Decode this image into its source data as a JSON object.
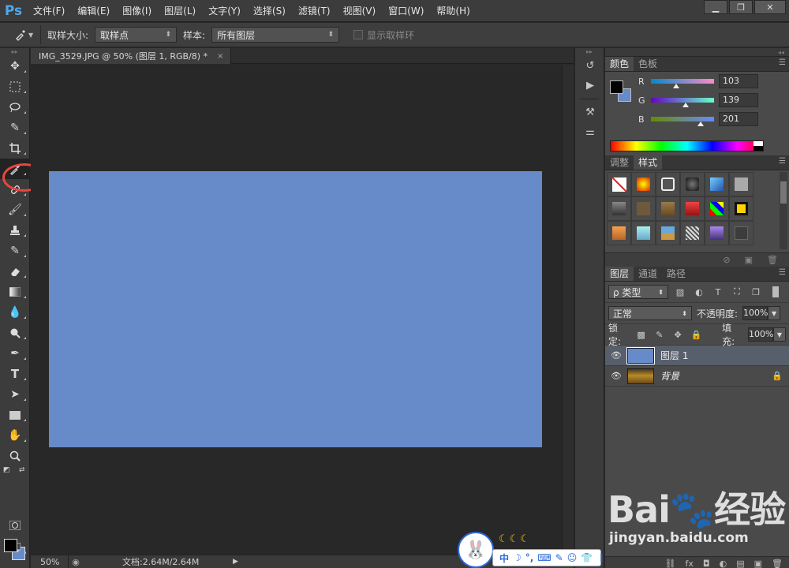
{
  "app": {
    "logo": "Ps"
  },
  "menu": [
    "文件(F)",
    "编辑(E)",
    "图像(I)",
    "图层(L)",
    "文字(Y)",
    "选择(S)",
    "滤镜(T)",
    "视图(V)",
    "窗口(W)",
    "帮助(H)"
  ],
  "window_controls": {
    "minimize": "▁",
    "restore": "❐",
    "close": "✕"
  },
  "options": {
    "sample_size_label": "取样大小:",
    "sample_size_value": "取样点",
    "sample_label": "样本:",
    "sample_value": "所有图层",
    "show_ring_label": "显示取样环"
  },
  "document": {
    "tab_title": "IMG_3529.JPG @ 50% (图层 1, RGB/8) *",
    "tab_close": "×",
    "fill_color": "#678ac9"
  },
  "status": {
    "zoom": "50%",
    "doc_size": "文档:2.64M/2.64M"
  },
  "foreground_color": "#000000",
  "background_color": "#678ac9",
  "panels": {
    "color_tabs": [
      "颜色",
      "色板"
    ],
    "color": {
      "channels": [
        {
          "label": "R",
          "value": "103",
          "fraction": 0.404
        },
        {
          "label": "G",
          "value": "139",
          "fraction": 0.545
        },
        {
          "label": "B",
          "value": "201",
          "fraction": 0.788
        }
      ]
    },
    "style_tabs": [
      "调整",
      "样式"
    ],
    "layers_tabs": [
      "图层",
      "通道",
      "路径"
    ],
    "layers": {
      "filter_label": "ρ 类型",
      "blend_mode": "正常",
      "opacity_label": "不透明度:",
      "opacity_value": "100%",
      "lock_label": "锁定:",
      "fill_label": "填充:",
      "fill_value": "100%",
      "items": [
        {
          "name": "图层 1",
          "selected": true,
          "thumb_color": "#678ac9"
        },
        {
          "name": "背景",
          "selected": false,
          "thumb_color": "#8a6a2a",
          "locked": true
        }
      ]
    }
  },
  "watermark": {
    "logo": "Bai🐾经验",
    "url": "jingyan.baidu.com"
  },
  "ime": {
    "label": "中",
    "items": [
      "☽",
      "°,",
      "⌨",
      "✎",
      "☺",
      "👕",
      "⋮"
    ]
  }
}
